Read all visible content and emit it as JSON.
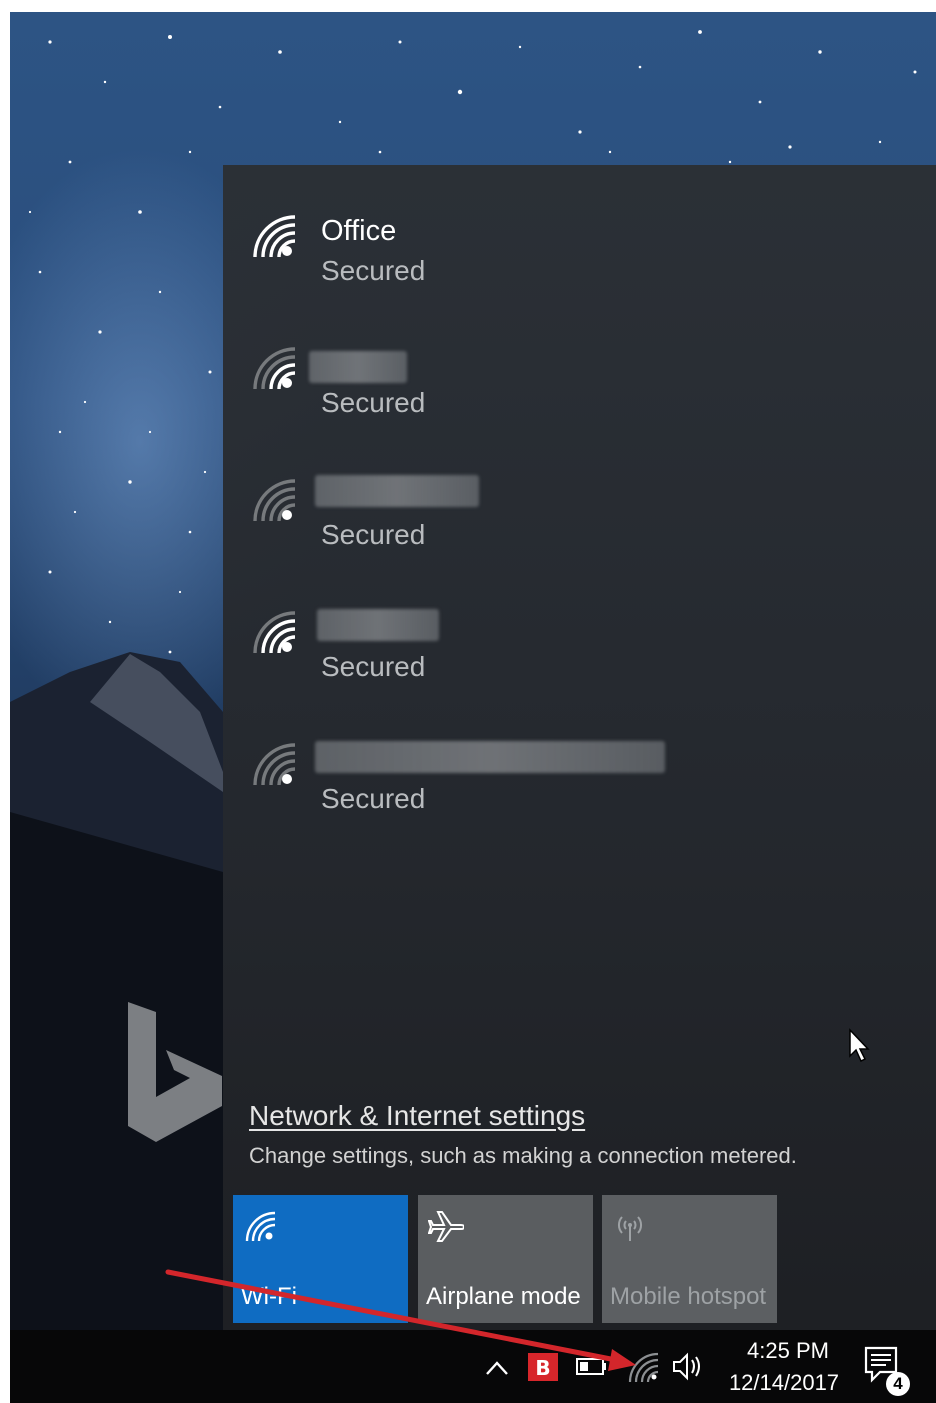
{
  "networks": [
    {
      "name": "Office",
      "status": "Secured",
      "signal_icon": "wifi-signal-icon"
    },
    {
      "name": "",
      "status": "Secured",
      "signal_icon": "wifi-signal-icon"
    },
    {
      "name": "",
      "status": "Secured",
      "signal_icon": "wifi-signal-icon"
    },
    {
      "name": "",
      "status": "Secured",
      "signal_icon": "wifi-signal-icon"
    },
    {
      "name": "",
      "status": "Secured",
      "signal_icon": "wifi-signal-icon"
    }
  ],
  "settings": {
    "link_label": "Network & Internet settings",
    "description": "Change settings, such as making a connection metered."
  },
  "quick_actions": [
    {
      "label": "Wi-Fi",
      "icon": "wifi-icon",
      "active": true
    },
    {
      "label": "Airplane mode",
      "icon": "airplane-icon",
      "active": false
    },
    {
      "label": "Mobile hotspot",
      "icon": "hotspot-icon",
      "active": false,
      "disabled": true
    }
  ],
  "taskbar": {
    "time": "4:25 PM",
    "date": "12/14/2017",
    "notification_count": "4"
  },
  "colors": {
    "accent": "#0f6cc2",
    "flyout_bg": "#2b2f34",
    "annotation_arrow": "#d3262b"
  }
}
